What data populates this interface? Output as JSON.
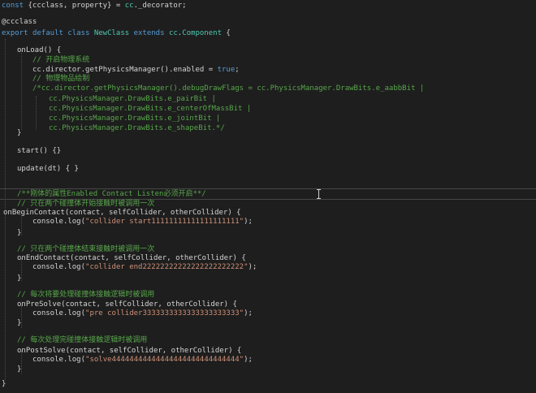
{
  "code": {
    "l1": [
      "const ",
      "{ccclass, property}",
      " = ",
      "cc",
      "._decorator;"
    ],
    "l3": "@ccclass",
    "l4": [
      "export",
      " ",
      "default",
      " ",
      "class",
      " ",
      "NewClass",
      " ",
      "extends",
      " ",
      "cc",
      ".",
      "Component",
      " {"
    ],
    "l6": "onLoad() {",
    "l7": "// 开启物理系统",
    "l8": [
      "cc.director.getPhysicsManager().enabled = ",
      "true",
      ";"
    ],
    "l9": "// 物理物品绘制",
    "l10": "/*cc.director.getPhysicsManager().debugDrawFlags = cc.PhysicsManager.DrawBits.e_aabbBit |",
    "l11": "cc.PhysicsManager.DrawBits.e_pairBit |",
    "l12": "cc.PhysicsManager.DrawBits.e_centerOfMassBit |",
    "l13": "cc.PhysicsManager.DrawBits.e_jointBit |",
    "l14": "cc.PhysicsManager.DrawBits.e_shapeBit.*/",
    "l15": "}",
    "l17": "start() {}",
    "l19": "update(dt) { }",
    "l22": "/**刚体的属性Enabled Contact Listen必须开启**/",
    "l23": "// 只在两个碰撞体开始接触时被调用一次",
    "l24": "onBeginContact(contact, selfCollider, otherCollider) {",
    "l25": [
      "console.log(",
      "\"collider start11111111111111111111\"",
      ");"
    ],
    "l26": "}",
    "l28": "// 只在两个碰撞体结束接触时被调用一次",
    "l29": "onEndContact(contact, selfCollider, otherCollider) {",
    "l30": [
      "console.log(",
      "\"collider end22222222222222222222222\"",
      ");"
    ],
    "l31": "}",
    "l33": "// 每次将要处理碰撞体接触逻辑时被调用",
    "l34": "onPreSolve(contact, selfCollider, otherCollider) {",
    "l35": [
      "console.log(",
      "\"pre collider3333333333333333333333\"",
      ");"
    ],
    "l36": "}",
    "l38": "// 每次处理完碰撞体接触逻辑时被调用",
    "l39": "onPostSolve(contact, selfCollider, otherCollider) {",
    "l40": [
      "console.log(",
      "\"solve44444444444444444444444444444\"",
      ");"
    ],
    "l41": "}",
    "l43": "}"
  },
  "colors": {
    "background": "#1e1e1e",
    "keyword": "#569cd6",
    "type": "#4ec9b0",
    "string": "#ce9178",
    "comment": "#57a64a",
    "text": "#d4d4d4"
  }
}
